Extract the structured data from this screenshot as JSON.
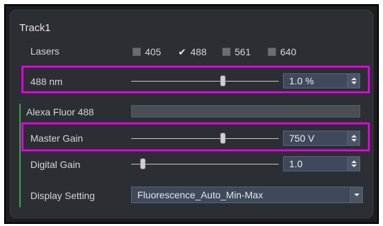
{
  "track": {
    "title": "Track1"
  },
  "lasers": {
    "label": "Lasers",
    "items": [
      {
        "label": "405",
        "checked": false
      },
      {
        "label": "488",
        "checked": true
      },
      {
        "label": "561",
        "checked": false
      },
      {
        "label": "640",
        "checked": false
      }
    ]
  },
  "laser_488": {
    "label": "488 nm",
    "value": "1.0 %",
    "slider_fraction": 0.62
  },
  "dye": {
    "label": "Alexa Fluor 488"
  },
  "master_gain": {
    "label": "Master Gain",
    "value": "750 V",
    "slider_fraction": 0.62
  },
  "digital_gain": {
    "label": "Digital Gain",
    "value": "1.0",
    "slider_fraction": 0.08
  },
  "display_setting": {
    "label": "Display Setting",
    "value": "Fluorescence_Auto_Min-Max"
  },
  "colors": {
    "highlight": "#e000e0",
    "panel_bg": "#2b2e33",
    "field_bg": "#3e4a5c",
    "channel_line": "#3aa84a"
  }
}
